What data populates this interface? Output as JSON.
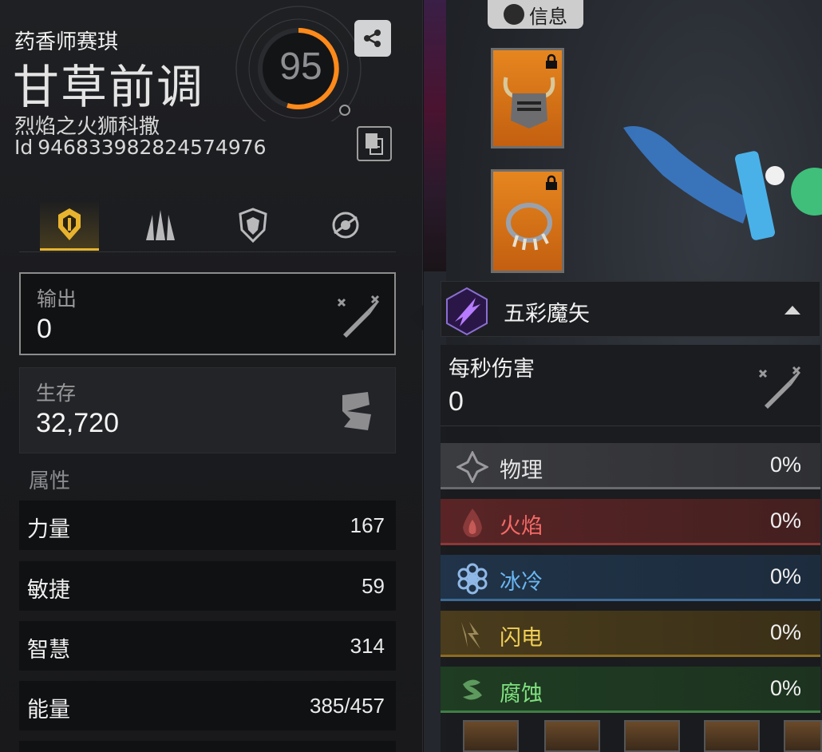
{
  "character": {
    "guild": "药香师赛琪",
    "name": "甘草前调",
    "class": "烈焰之火狮科撒",
    "id_prefix": "Id",
    "id": "946833982824574976",
    "level": "95"
  },
  "tabs": [
    {
      "name": "tab-offense",
      "icon": "helmet-icon",
      "active": true
    },
    {
      "name": "tab-skills",
      "icon": "claws-icon",
      "active": false
    },
    {
      "name": "tab-defense",
      "icon": "shield-icon",
      "active": false
    },
    {
      "name": "tab-misc",
      "icon": "crosshair-icon",
      "active": false
    }
  ],
  "stats": {
    "output": {
      "label": "输出",
      "value": "0",
      "icon": "crossed-swords-icon"
    },
    "survival": {
      "label": "生存",
      "value": "32,720",
      "icon": "shield-emblem-icon"
    }
  },
  "attributes": {
    "title": "属性",
    "rows": [
      {
        "name": "力量",
        "value": "167"
      },
      {
        "name": "敏捷",
        "value": "59"
      },
      {
        "name": "智慧",
        "value": "314"
      },
      {
        "name": "能量",
        "value": "385/457"
      }
    ]
  },
  "scene": {
    "info_tab_label": "信息",
    "equipment": [
      {
        "name": "horned-helmet",
        "locked": true
      },
      {
        "name": "spiked-necklace",
        "locked": true
      }
    ]
  },
  "skill_popup": {
    "skill_name": "五彩魔矢",
    "dps_label": "每秒伤害",
    "dps_value": "0",
    "elements": [
      {
        "key": "physical",
        "name": "物理",
        "pct": "0%",
        "color": "#e6e6e6"
      },
      {
        "key": "fire",
        "name": "火焰",
        "pct": "0%",
        "color": "#f46a66"
      },
      {
        "key": "cold",
        "name": "冰冷",
        "pct": "0%",
        "color": "#69b6f2"
      },
      {
        "key": "lightning",
        "name": "闪电",
        "pct": "0%",
        "color": "#f1cf56"
      },
      {
        "key": "poison",
        "name": "腐蚀",
        "pct": "0%",
        "color": "#7fe07f"
      }
    ]
  },
  "colors": {
    "accent_gold": "#e8b42f",
    "level_ring": "#ff8a1a",
    "equip_orange": "#e6861f"
  }
}
